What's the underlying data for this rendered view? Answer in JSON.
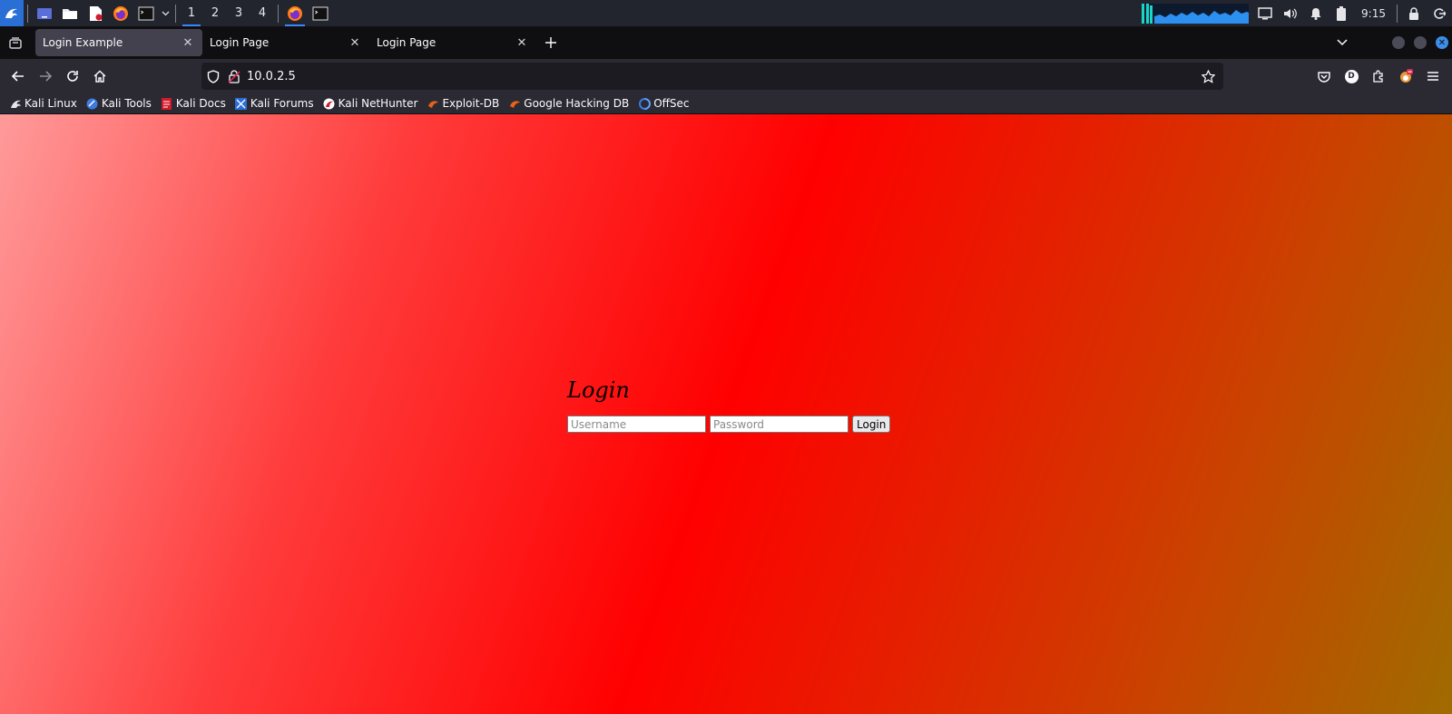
{
  "panel": {
    "workspaces": [
      {
        "label": "1",
        "active": true
      },
      {
        "label": "2",
        "active": false
      },
      {
        "label": "3",
        "active": false
      },
      {
        "label": "4",
        "active": false
      }
    ],
    "clock": "9:15"
  },
  "tabs": [
    {
      "label": "Login Example",
      "active": true
    },
    {
      "label": "Login Page",
      "active": false
    },
    {
      "label": "Login Page",
      "active": false
    }
  ],
  "navbar": {
    "url": "10.0.2.5",
    "account_initial": "D"
  },
  "bookmarks": [
    {
      "label": "Kali Linux",
      "icon": "kali-dragon-icon",
      "color": "#1b1b1b"
    },
    {
      "label": "Kali Tools",
      "icon": "kali-tools-icon",
      "color": "#3c7be0"
    },
    {
      "label": "Kali Docs",
      "icon": "kali-docs-icon",
      "color": "#d11a2a"
    },
    {
      "label": "Kali Forums",
      "icon": "kali-forums-icon",
      "color": "#2a6fd6"
    },
    {
      "label": "Kali NetHunter",
      "icon": "nethunter-icon",
      "color": "#d11a2a"
    },
    {
      "label": "Exploit-DB",
      "icon": "exploit-db-icon",
      "color": "#e8621a"
    },
    {
      "label": "Google Hacking DB",
      "icon": "ghdb-icon",
      "color": "#e8621a"
    },
    {
      "label": "OffSec",
      "icon": "offsec-icon",
      "color": "#3c7be0"
    }
  ],
  "page": {
    "heading": "Login",
    "username_placeholder": "Username",
    "password_placeholder": "Password",
    "login_button": "Login"
  },
  "colors": {
    "accent": "#3a86ff",
    "gradient": [
      "#ff9a9a",
      "#ff0000",
      "#a06b00"
    ]
  }
}
